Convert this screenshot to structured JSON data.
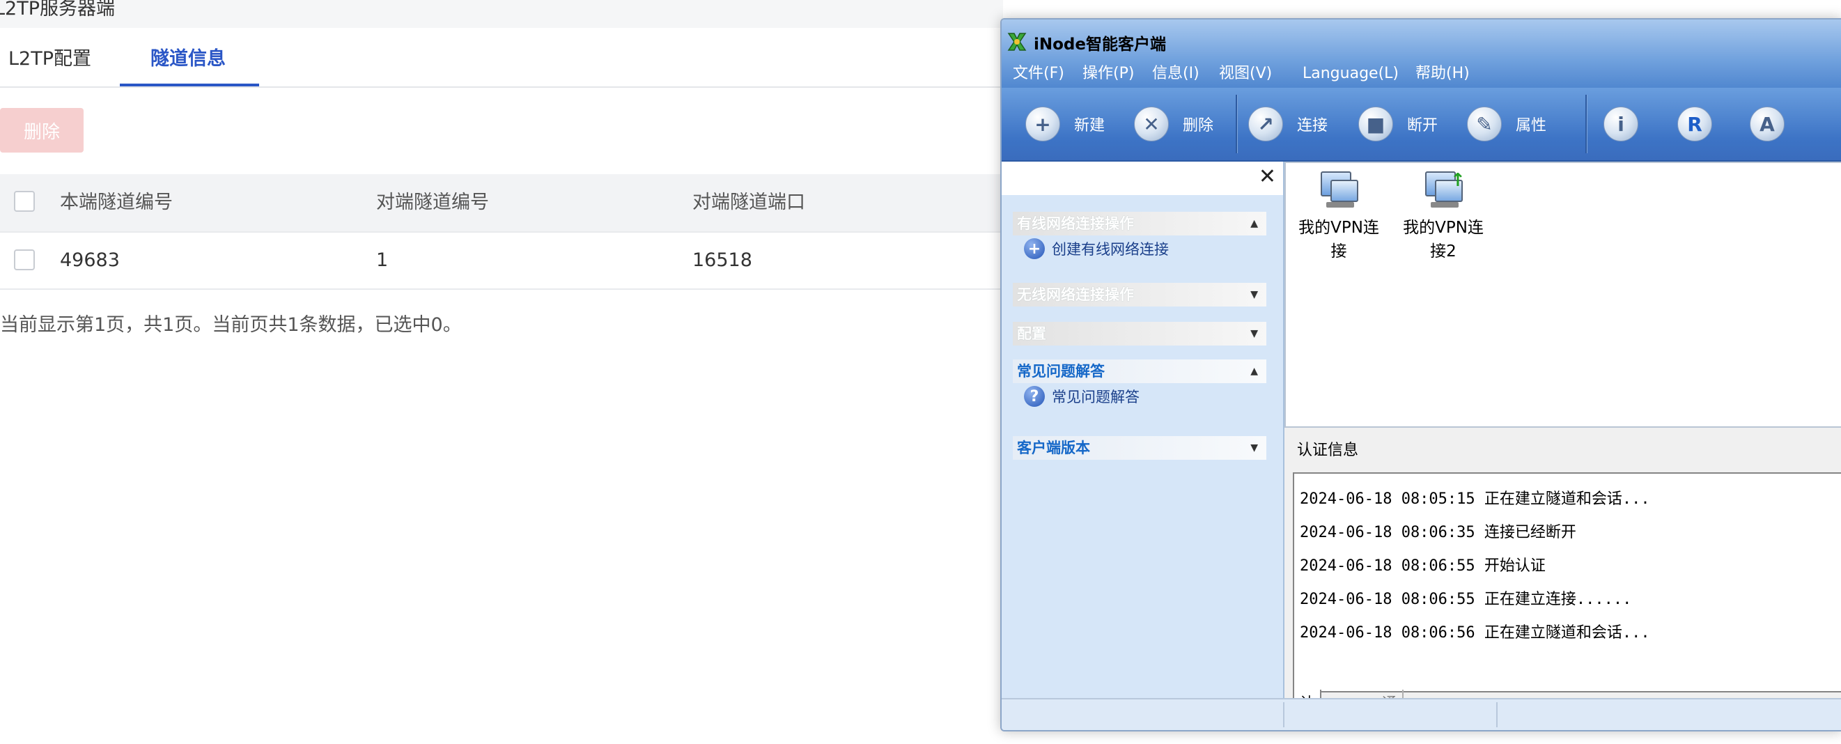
{
  "web": {
    "title": "L2TP服务器端",
    "tabs": [
      {
        "label": "L2TP配置"
      },
      {
        "label": "隧道信息"
      }
    ],
    "delete_label": "删除",
    "table": {
      "columns": [
        "本端隧道编号",
        "对端隧道编号",
        "对端隧道端口"
      ],
      "rows": [
        [
          "49683",
          "1",
          "16518"
        ]
      ]
    },
    "summary": "当前显示第1页，共1页。当前页共1条数据，已选中0。"
  },
  "inode": {
    "title": "iNode智能客户端",
    "menu": [
      "文件(F)",
      "操作(P)",
      "信息(I)",
      "视图(V)",
      "Language(L)",
      "帮助(H)"
    ],
    "toolbar": [
      {
        "label": "新建",
        "icon": "plus-icon",
        "glyph": "+"
      },
      {
        "label": "删除",
        "icon": "delete-icon",
        "glyph": "✕"
      },
      {
        "label": "连接",
        "icon": "connect-icon",
        "glyph": "↗"
      },
      {
        "label": "断开",
        "icon": "disconnect-icon",
        "glyph": "■"
      },
      {
        "label": "属性",
        "icon": "properties-icon",
        "glyph": "✎"
      },
      {
        "label": "",
        "icon": "info-icon",
        "glyph": "i"
      },
      {
        "label": "",
        "icon": "r-icon",
        "glyph": "R"
      },
      {
        "label": "",
        "icon": "a-icon",
        "glyph": "A"
      }
    ],
    "left_pane": {
      "close_glyph": "✕",
      "groups": [
        {
          "title": "有线网络连接操作",
          "expanded": true,
          "items": [
            "创建有线网络连接"
          ]
        },
        {
          "title": "无线网络连接操作",
          "expanded": false,
          "items": []
        },
        {
          "title": "配置",
          "expanded": false,
          "items": []
        },
        {
          "title": "常见问题解答",
          "expanded": true,
          "items": [
            "常见问题解答"
          ]
        },
        {
          "title": "客户端版本",
          "expanded": false,
          "items": []
        }
      ]
    },
    "connections": [
      {
        "line1": "我的VPN连",
        "line2": "接"
      },
      {
        "line1": "我的VPN连",
        "line2": "接2"
      }
    ],
    "auth_label": "认证信息",
    "log": [
      "2024-06-18 08:05:15 正在建立隧道和会话...",
      "2024-06-18 08:06:35 连接已经断开",
      "2024-06-18 08:06:55 开始认证",
      "2024-06-18 08:06:55 正在建立连接......",
      "2024-06-18 08:06:56 正在建立隧道和会话..."
    ],
    "log_tabs": [
      "认证信息",
      "通知"
    ]
  }
}
